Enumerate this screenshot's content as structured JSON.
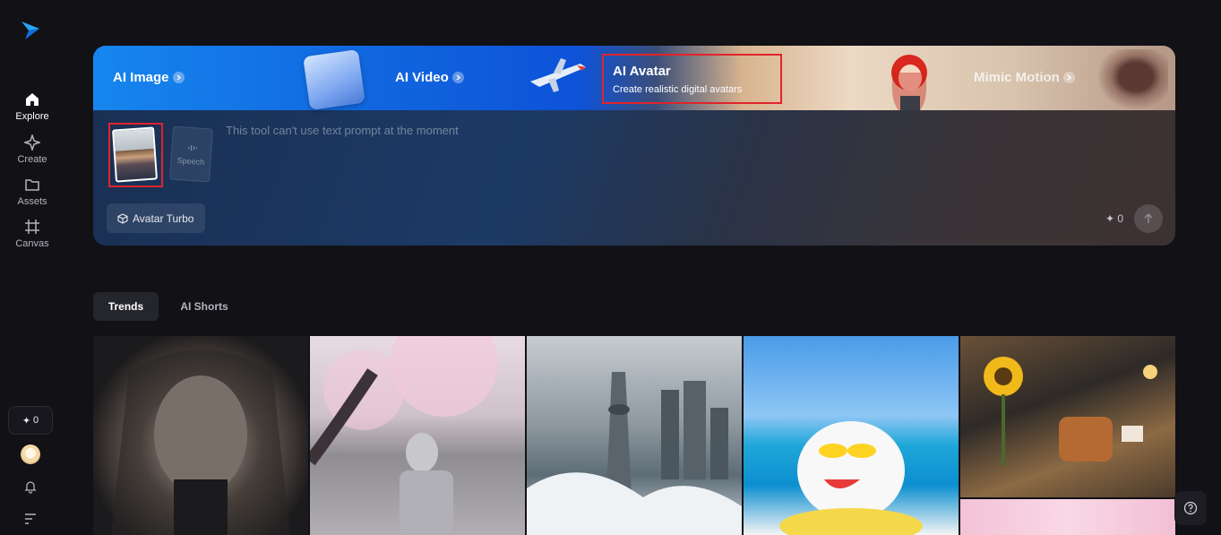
{
  "sidebar": {
    "items": [
      {
        "label": "Explore",
        "icon": "home-icon"
      },
      {
        "label": "Create",
        "icon": "sparkle-icon"
      },
      {
        "label": "Assets",
        "icon": "folder-icon"
      },
      {
        "label": "Canvas",
        "icon": "canvas-icon"
      }
    ],
    "credits": "0"
  },
  "hero": {
    "tabs": [
      {
        "label": "AI Image"
      },
      {
        "label": "AI Video"
      },
      {
        "label": "AI Avatar",
        "subtitle": "Create realistic digital avatars"
      },
      {
        "label": "Mimic Motion"
      }
    ],
    "speech_label": "Speech",
    "prompt_placeholder": "This tool can't use text prompt at the moment",
    "model_label": "Avatar Turbo",
    "cost": "0"
  },
  "content_tabs": [
    {
      "label": "Trends"
    },
    {
      "label": "AI Shorts"
    }
  ],
  "colors": {
    "accent_red": "#e0242b",
    "background": "#111116",
    "brand_blue": "#1686ee"
  }
}
